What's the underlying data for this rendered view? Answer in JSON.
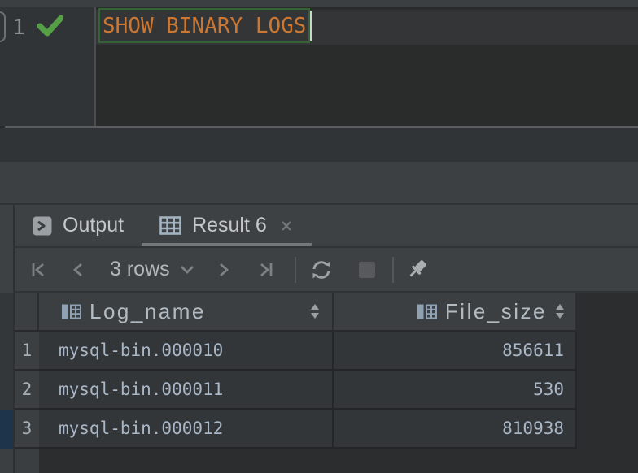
{
  "editor": {
    "line_number": "1",
    "sql_statement": "SHOW BINARY LOGS",
    "run_status": "success"
  },
  "panel": {
    "tabs": [
      {
        "label": "Output",
        "icon": "terminal-icon",
        "active": false
      },
      {
        "label": "Result 6",
        "icon": "table-icon",
        "active": true,
        "closable": true
      }
    ],
    "toolbar": {
      "rows_count_label": "3 rows",
      "buttons": [
        "first-page",
        "previous-page",
        "rows-dropdown",
        "next-page",
        "last-page",
        "refresh",
        "stop",
        "pin"
      ]
    }
  },
  "result_table": {
    "columns": [
      {
        "name": "Log_name",
        "align": "left",
        "sortable": true
      },
      {
        "name": "File_size",
        "align": "right",
        "sortable": true
      }
    ],
    "rows": [
      {
        "num": "1",
        "log_name": "mysql-bin.000010",
        "file_size": "856611"
      },
      {
        "num": "2",
        "log_name": "mysql-bin.000011",
        "file_size": "530"
      },
      {
        "num": "3",
        "log_name": "mysql-bin.000012",
        "file_size": "810938"
      }
    ]
  },
  "icons": {
    "run_success": "green checkmark",
    "terminal": "gray rounded square with > chevron",
    "table": "light blue-gray grid",
    "close": "x cross",
    "first_page": "|< bar with left chevron",
    "previous_page": "< left chevron",
    "dropdown": "v chevron down",
    "next_page": "> right chevron",
    "last_page": ">| right chevron with bar",
    "refresh": "two circular arrows",
    "stop": "solid gray square",
    "pin": "pushpin tilted left",
    "column_header": "table column grid",
    "sort": "up and down triangles"
  },
  "colors": {
    "keyword_orange": "#cc7832",
    "success_green": "#55a047",
    "statement_border_green": "#356335",
    "row_marker_blue": "#1e344b",
    "active_tab_underline": "#75787b",
    "cell_text": "#a9b7c6"
  }
}
